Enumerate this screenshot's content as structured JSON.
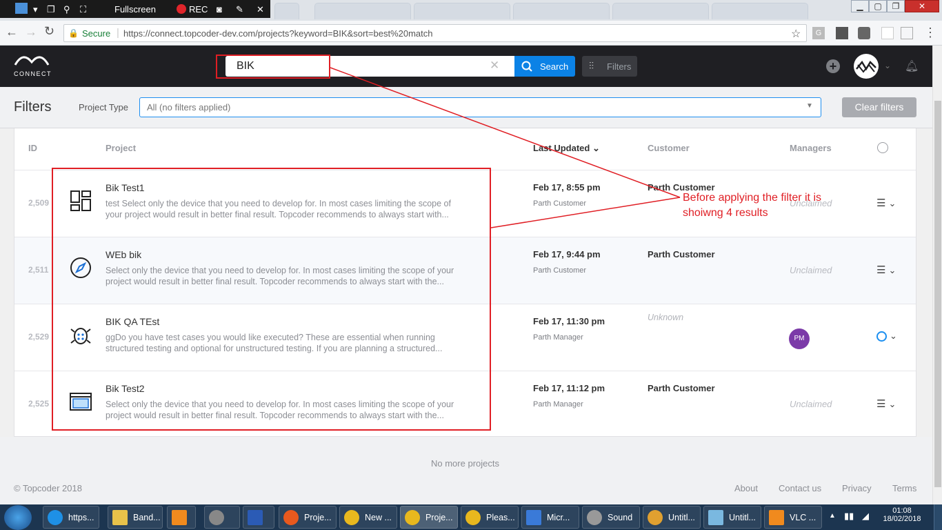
{
  "recorder": {
    "fullscreen_label": "Fullscreen",
    "rec_label": "REC"
  },
  "browser": {
    "secure_label": "Secure",
    "url": "https://connect.topcoder-dev.com/projects?keyword=BIK&sort=best%20match"
  },
  "header": {
    "logo_text": "CONNECT",
    "search_value": "BIK",
    "search_button": "Search",
    "filters_button": "Filters"
  },
  "filters": {
    "title": "Filters",
    "project_type_label": "Project Type",
    "project_type_value": "All (no filters applied)",
    "clear_button": "Clear filters"
  },
  "table": {
    "headers": {
      "id": "ID",
      "project": "Project",
      "last_updated": "Last Updated",
      "customer": "Customer",
      "managers": "Managers"
    },
    "rows": [
      {
        "id": "2,509",
        "title": "Bik Test1",
        "desc": "test Select only the device that you need to develop for. In most cases limiting the scope of\nyour project would result in better final result. Topcoder recommends to always start with...",
        "date": "Feb 17, 8:55 pm",
        "by": "Parth Customer",
        "customer": "Parth Customer",
        "manager": "Unclaimed",
        "icon": "grid-layout-icon"
      },
      {
        "id": "2,511",
        "title": "WEb bik",
        "desc": "Select only the device that you need to develop for. In most cases limiting the scope of your\nproject would result in better final result. Topcoder recommends to always start with the...",
        "date": "Feb 17, 9:44 pm",
        "by": "Parth Customer",
        "customer": "Parth Customer",
        "manager": "Unclaimed",
        "icon": "compass-icon"
      },
      {
        "id": "2,529",
        "title": "BIK QA TEst",
        "desc": "ggDo you have test cases you would like executed? These are essential when running\nstructured testing and optional for unstructured testing. If you are planning a structured...",
        "date": "Feb 17, 11:30 pm",
        "by": "Parth Manager",
        "customer": "Unknown",
        "manager": "PM",
        "icon": "bug-icon"
      },
      {
        "id": "2,525",
        "title": "Bik Test2",
        "desc": "Select only the device that you need to develop for. In most cases limiting the scope of your\nproject would result in better final result. Topcoder recommends to always start with the...",
        "date": "Feb 17, 11:12 pm",
        "by": "Parth Manager",
        "customer": "Parth Customer",
        "manager": "Unclaimed",
        "icon": "browser-window-icon"
      }
    ]
  },
  "footer": {
    "no_more": "No more projects",
    "copyright": "© Topcoder 2018",
    "links": [
      "About",
      "Contact us",
      "Privacy",
      "Terms"
    ]
  },
  "annotation": {
    "line1": "Before applying the filter it is",
    "line2": "shoiwng 4 results"
  },
  "taskbar": {
    "items": [
      "https...",
      "Band...",
      "",
      "",
      "",
      "Proje...",
      "New ...",
      "Proje...",
      "Pleas...",
      "Micr...",
      "Sound",
      "Untitl...",
      "Untitl...",
      "VLC ..."
    ],
    "time": "01:08",
    "date": "18/02/2018"
  }
}
